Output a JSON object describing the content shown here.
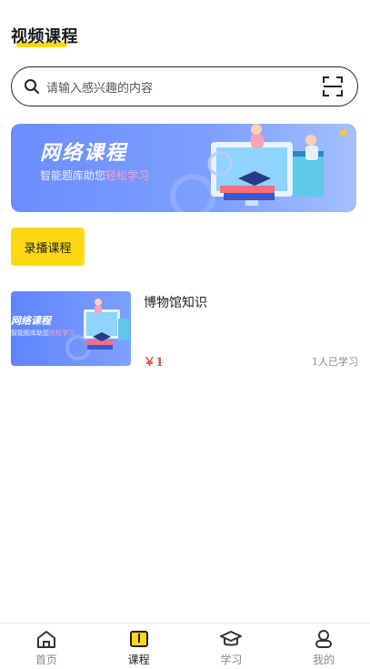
{
  "header": {
    "title": "视频课程"
  },
  "search": {
    "placeholder": "请输入感兴趣的内容"
  },
  "banner": {
    "title": "网络课程",
    "subtitle_prefix": "智能题库助您",
    "subtitle_highlight": "轻松学习"
  },
  "categories": [
    {
      "label": "录播课程",
      "active": true
    }
  ],
  "courses": [
    {
      "thumb_title": "网络课程",
      "thumb_sub_prefix": "智能题库助您",
      "thumb_sub_highlight": "轻松学习",
      "name": "博物馆知识",
      "price": "￥1",
      "learners": "1人已学习"
    }
  ],
  "tabbar": {
    "items": [
      {
        "label": "首页",
        "icon": "home-icon",
        "active": false
      },
      {
        "label": "课程",
        "icon": "book-icon",
        "active": true
      },
      {
        "label": "学习",
        "icon": "graduation-cap-icon",
        "active": false
      },
      {
        "label": "我的",
        "icon": "user-icon",
        "active": false
      }
    ]
  },
  "colors": {
    "accent": "#ffd814",
    "price": "#e0524a",
    "banner": "#6b8cff"
  }
}
